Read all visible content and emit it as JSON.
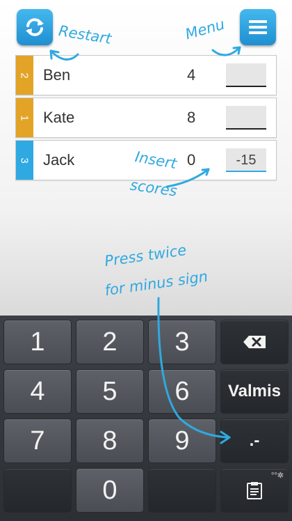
{
  "topbar": {
    "restart_icon": "refresh-icon",
    "menu_icon": "hamburger-menu-icon"
  },
  "players": [
    {
      "rank": "2",
      "name": "Ben",
      "score": "4",
      "input": "",
      "rank_color": "#e2a326"
    },
    {
      "rank": "1",
      "name": "Kate",
      "score": "8",
      "input": "",
      "rank_color": "#e2a326"
    },
    {
      "rank": "3",
      "name": "Jack",
      "score": "0",
      "input": "-15",
      "rank_color": "#2fa9e1"
    }
  ],
  "hints": {
    "restart": "Restart",
    "menu": "Menu",
    "insert": "Insert",
    "scores": "scores",
    "press": "Press twice",
    "minus": "for minus sign"
  },
  "keyboard": {
    "keys": [
      "1",
      "2",
      "3",
      "4",
      "5",
      "6",
      "7",
      "8",
      "9",
      "0"
    ],
    "backspace_icon": "backspace-icon",
    "done_label": "Valmis",
    "minus_label": ".-",
    "clipboard_icon": "clipboard-icon",
    "settings_dots": "°°✲"
  },
  "colors": {
    "accent": "#2fa9e1",
    "leader": "#e2a326",
    "keyboard_bg": "#3a3e43"
  }
}
